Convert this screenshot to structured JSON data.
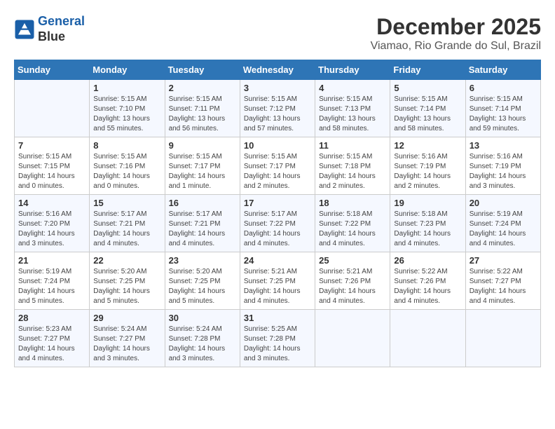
{
  "header": {
    "logo_line1": "General",
    "logo_line2": "Blue",
    "month": "December 2025",
    "location": "Viamao, Rio Grande do Sul, Brazil"
  },
  "weekdays": [
    "Sunday",
    "Monday",
    "Tuesday",
    "Wednesday",
    "Thursday",
    "Friday",
    "Saturday"
  ],
  "weeks": [
    [
      {
        "day": "",
        "sunrise": "",
        "sunset": "",
        "daylight": ""
      },
      {
        "day": "1",
        "sunrise": "Sunrise: 5:15 AM",
        "sunset": "Sunset: 7:10 PM",
        "daylight": "Daylight: 13 hours and 55 minutes."
      },
      {
        "day": "2",
        "sunrise": "Sunrise: 5:15 AM",
        "sunset": "Sunset: 7:11 PM",
        "daylight": "Daylight: 13 hours and 56 minutes."
      },
      {
        "day": "3",
        "sunrise": "Sunrise: 5:15 AM",
        "sunset": "Sunset: 7:12 PM",
        "daylight": "Daylight: 13 hours and 57 minutes."
      },
      {
        "day": "4",
        "sunrise": "Sunrise: 5:15 AM",
        "sunset": "Sunset: 7:13 PM",
        "daylight": "Daylight: 13 hours and 58 minutes."
      },
      {
        "day": "5",
        "sunrise": "Sunrise: 5:15 AM",
        "sunset": "Sunset: 7:14 PM",
        "daylight": "Daylight: 13 hours and 58 minutes."
      },
      {
        "day": "6",
        "sunrise": "Sunrise: 5:15 AM",
        "sunset": "Sunset: 7:14 PM",
        "daylight": "Daylight: 13 hours and 59 minutes."
      }
    ],
    [
      {
        "day": "7",
        "sunrise": "Sunrise: 5:15 AM",
        "sunset": "Sunset: 7:15 PM",
        "daylight": "Daylight: 14 hours and 0 minutes."
      },
      {
        "day": "8",
        "sunrise": "Sunrise: 5:15 AM",
        "sunset": "Sunset: 7:16 PM",
        "daylight": "Daylight: 14 hours and 0 minutes."
      },
      {
        "day": "9",
        "sunrise": "Sunrise: 5:15 AM",
        "sunset": "Sunset: 7:17 PM",
        "daylight": "Daylight: 14 hours and 1 minute."
      },
      {
        "day": "10",
        "sunrise": "Sunrise: 5:15 AM",
        "sunset": "Sunset: 7:17 PM",
        "daylight": "Daylight: 14 hours and 2 minutes."
      },
      {
        "day": "11",
        "sunrise": "Sunrise: 5:15 AM",
        "sunset": "Sunset: 7:18 PM",
        "daylight": "Daylight: 14 hours and 2 minutes."
      },
      {
        "day": "12",
        "sunrise": "Sunrise: 5:16 AM",
        "sunset": "Sunset: 7:19 PM",
        "daylight": "Daylight: 14 hours and 2 minutes."
      },
      {
        "day": "13",
        "sunrise": "Sunrise: 5:16 AM",
        "sunset": "Sunset: 7:19 PM",
        "daylight": "Daylight: 14 hours and 3 minutes."
      }
    ],
    [
      {
        "day": "14",
        "sunrise": "Sunrise: 5:16 AM",
        "sunset": "Sunset: 7:20 PM",
        "daylight": "Daylight: 14 hours and 3 minutes."
      },
      {
        "day": "15",
        "sunrise": "Sunrise: 5:17 AM",
        "sunset": "Sunset: 7:21 PM",
        "daylight": "Daylight: 14 hours and 4 minutes."
      },
      {
        "day": "16",
        "sunrise": "Sunrise: 5:17 AM",
        "sunset": "Sunset: 7:21 PM",
        "daylight": "Daylight: 14 hours and 4 minutes."
      },
      {
        "day": "17",
        "sunrise": "Sunrise: 5:17 AM",
        "sunset": "Sunset: 7:22 PM",
        "daylight": "Daylight: 14 hours and 4 minutes."
      },
      {
        "day": "18",
        "sunrise": "Sunrise: 5:18 AM",
        "sunset": "Sunset: 7:22 PM",
        "daylight": "Daylight: 14 hours and 4 minutes."
      },
      {
        "day": "19",
        "sunrise": "Sunrise: 5:18 AM",
        "sunset": "Sunset: 7:23 PM",
        "daylight": "Daylight: 14 hours and 4 minutes."
      },
      {
        "day": "20",
        "sunrise": "Sunrise: 5:19 AM",
        "sunset": "Sunset: 7:24 PM",
        "daylight": "Daylight: 14 hours and 4 minutes."
      }
    ],
    [
      {
        "day": "21",
        "sunrise": "Sunrise: 5:19 AM",
        "sunset": "Sunset: 7:24 PM",
        "daylight": "Daylight: 14 hours and 5 minutes."
      },
      {
        "day": "22",
        "sunrise": "Sunrise: 5:20 AM",
        "sunset": "Sunset: 7:25 PM",
        "daylight": "Daylight: 14 hours and 5 minutes."
      },
      {
        "day": "23",
        "sunrise": "Sunrise: 5:20 AM",
        "sunset": "Sunset: 7:25 PM",
        "daylight": "Daylight: 14 hours and 5 minutes."
      },
      {
        "day": "24",
        "sunrise": "Sunrise: 5:21 AM",
        "sunset": "Sunset: 7:25 PM",
        "daylight": "Daylight: 14 hours and 4 minutes."
      },
      {
        "day": "25",
        "sunrise": "Sunrise: 5:21 AM",
        "sunset": "Sunset: 7:26 PM",
        "daylight": "Daylight: 14 hours and 4 minutes."
      },
      {
        "day": "26",
        "sunrise": "Sunrise: 5:22 AM",
        "sunset": "Sunset: 7:26 PM",
        "daylight": "Daylight: 14 hours and 4 minutes."
      },
      {
        "day": "27",
        "sunrise": "Sunrise: 5:22 AM",
        "sunset": "Sunset: 7:27 PM",
        "daylight": "Daylight: 14 hours and 4 minutes."
      }
    ],
    [
      {
        "day": "28",
        "sunrise": "Sunrise: 5:23 AM",
        "sunset": "Sunset: 7:27 PM",
        "daylight": "Daylight: 14 hours and 4 minutes."
      },
      {
        "day": "29",
        "sunrise": "Sunrise: 5:24 AM",
        "sunset": "Sunset: 7:27 PM",
        "daylight": "Daylight: 14 hours and 3 minutes."
      },
      {
        "day": "30",
        "sunrise": "Sunrise: 5:24 AM",
        "sunset": "Sunset: 7:28 PM",
        "daylight": "Daylight: 14 hours and 3 minutes."
      },
      {
        "day": "31",
        "sunrise": "Sunrise: 5:25 AM",
        "sunset": "Sunset: 7:28 PM",
        "daylight": "Daylight: 14 hours and 3 minutes."
      },
      {
        "day": "",
        "sunrise": "",
        "sunset": "",
        "daylight": ""
      },
      {
        "day": "",
        "sunrise": "",
        "sunset": "",
        "daylight": ""
      },
      {
        "day": "",
        "sunrise": "",
        "sunset": "",
        "daylight": ""
      }
    ]
  ]
}
